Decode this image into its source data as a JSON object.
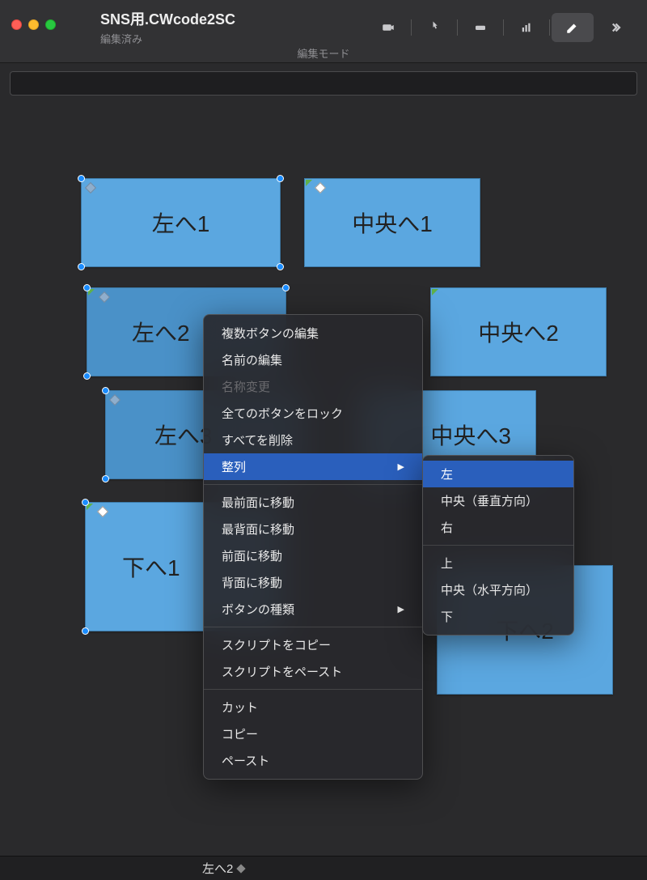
{
  "window": {
    "title": "SNS用.CWcode2SC",
    "subtitle": "編集済み",
    "mode_label": "編集モード"
  },
  "buttons": [
    {
      "label": "左へ1"
    },
    {
      "label": "中央へ1"
    },
    {
      "label": "左へ2"
    },
    {
      "label": "中央へ2"
    },
    {
      "label": "左へ3"
    },
    {
      "label": "中央へ3"
    },
    {
      "label": "下へ1"
    },
    {
      "label": "下へ2"
    }
  ],
  "context_menu": {
    "items": [
      {
        "label": "複数ボタンの編集",
        "enabled": true
      },
      {
        "label": "名前の編集",
        "enabled": true
      },
      {
        "label": "名称変更",
        "enabled": false
      },
      {
        "label": "全てのボタンをロック",
        "enabled": true
      },
      {
        "label": "すべてを削除",
        "enabled": true
      },
      {
        "label": "整列",
        "enabled": true,
        "submenu": true,
        "highlighted": true
      }
    ],
    "group2": [
      {
        "label": "最前面に移動"
      },
      {
        "label": "最背面に移動"
      },
      {
        "label": "前面に移動"
      },
      {
        "label": "背面に移動"
      },
      {
        "label": "ボタンの種類",
        "submenu": true
      }
    ],
    "group3": [
      {
        "label": "スクリプトをコピー"
      },
      {
        "label": "スクリプトをペースト"
      }
    ],
    "group4": [
      {
        "label": "カット"
      },
      {
        "label": "コピー"
      },
      {
        "label": "ペースト"
      }
    ]
  },
  "submenu": {
    "items1": [
      {
        "label": "左",
        "highlighted": true
      },
      {
        "label": "中央（垂直方向）"
      },
      {
        "label": "右"
      }
    ],
    "items2": [
      {
        "label": "上"
      },
      {
        "label": "中央（水平方向）"
      },
      {
        "label": "下"
      }
    ]
  },
  "statusbar": {
    "label": "左へ2"
  }
}
